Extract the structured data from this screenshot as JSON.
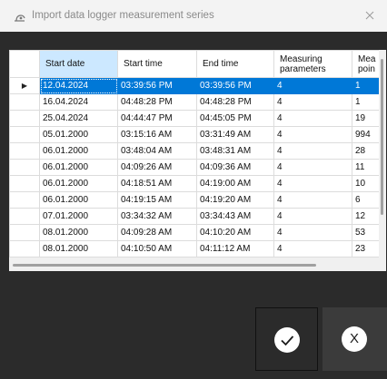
{
  "window": {
    "title": "Import data logger measurement series"
  },
  "grid": {
    "columns": [
      "Start date",
      "Start time",
      "End time",
      "Measuring\nparameters",
      "Mea\npoin"
    ],
    "rows": [
      [
        "12.04.2024",
        "03:39:56 PM",
        "03:39:56 PM",
        "4",
        "1"
      ],
      [
        "16.04.2024",
        "04:48:28 PM",
        "04:48:28 PM",
        "4",
        "1"
      ],
      [
        "25.04.2024",
        "04:44:47 PM",
        "04:45:05 PM",
        "4",
        "19"
      ],
      [
        "05.01.2000",
        "03:15:16 AM",
        "03:31:49 AM",
        "4",
        "994"
      ],
      [
        "06.01.2000",
        "03:48:04 AM",
        "03:48:31 AM",
        "4",
        "28"
      ],
      [
        "06.01.2000",
        "04:09:26 AM",
        "04:09:36 AM",
        "4",
        "11"
      ],
      [
        "06.01.2000",
        "04:18:51 AM",
        "04:19:00 AM",
        "4",
        "10"
      ],
      [
        "06.01.2000",
        "04:19:15 AM",
        "04:19:20 AM",
        "4",
        "6"
      ],
      [
        "07.01.2000",
        "03:34:32 AM",
        "03:34:43 AM",
        "4",
        "12"
      ],
      [
        "08.01.2000",
        "04:09:28 AM",
        "04:10:20 AM",
        "4",
        "53"
      ],
      [
        "08.01.2000",
        "04:10:50 AM",
        "04:11:12 AM",
        "4",
        "23"
      ]
    ],
    "selected_row": 0,
    "row_pointer_glyph": "▶"
  },
  "actions": {
    "ok_icon": "checkmark-icon",
    "cancel_label": "X"
  },
  "colors": {
    "selection": "#0078d7",
    "sorted_header": "#cce8ff",
    "background": "#2b2b2b"
  }
}
